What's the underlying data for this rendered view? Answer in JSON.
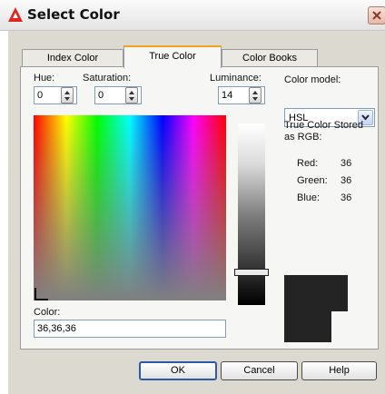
{
  "window": {
    "title": "Select Color",
    "close_icon": "close-x-icon",
    "app_icon": "autocad-logo-icon"
  },
  "tabs": [
    {
      "label": "Index Color",
      "active": false
    },
    {
      "label": "True Color",
      "active": true
    },
    {
      "label": "Color Books",
      "active": false
    }
  ],
  "true_color": {
    "hue": {
      "label": "Hue:",
      "value": "0"
    },
    "saturation": {
      "label": "Saturation:",
      "value": "0"
    },
    "luminance": {
      "label": "Luminance:",
      "value": "14"
    },
    "color_model": {
      "label": "Color model:",
      "selected": "HSL"
    },
    "stored_label": "True Color Stored as RGB:",
    "rgb": {
      "red_label": "Red:",
      "red": "36",
      "green_label": "Green:",
      "green": "36",
      "blue_label": "Blue:",
      "blue": "36"
    },
    "color_field": {
      "label": "Color:",
      "value": "36,36,36"
    },
    "swatch_color": "#242424",
    "luminance_level_percent": 14
  },
  "buttons": {
    "ok": "OK",
    "cancel": "Cancel",
    "help": "Help"
  }
}
